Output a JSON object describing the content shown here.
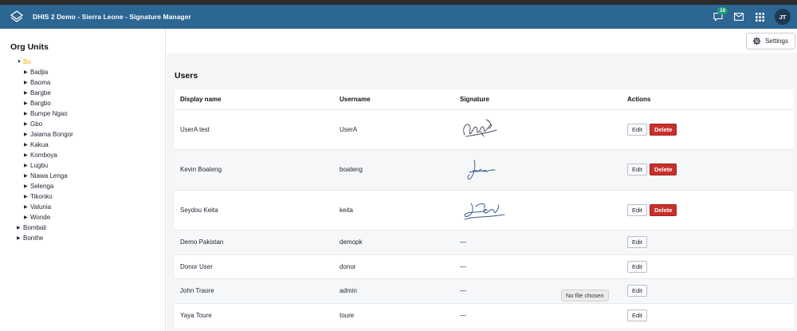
{
  "header": {
    "title": "DHIS 2 Demo - Sierra Leone - Signature Manager",
    "notification_count": "10",
    "avatar_initials": "JT",
    "bg_color": "#2c6693"
  },
  "sidebar": {
    "title": "Org Units",
    "tree": [
      {
        "label": "Bo",
        "level": 0,
        "expanded": true,
        "selected": true
      },
      {
        "label": "Badjia",
        "level": 1
      },
      {
        "label": "Baoma",
        "level": 1
      },
      {
        "label": "Bargbe",
        "level": 1
      },
      {
        "label": "Bargbo",
        "level": 1
      },
      {
        "label": "Bumpe Ngao",
        "level": 1
      },
      {
        "label": "Gbo",
        "level": 1
      },
      {
        "label": "Jaiama Bongor",
        "level": 1
      },
      {
        "label": "Kakua",
        "level": 1
      },
      {
        "label": "Komboya",
        "level": 1
      },
      {
        "label": "Lugbu",
        "level": 1
      },
      {
        "label": "Niawa Lenga",
        "level": 1
      },
      {
        "label": "Selenga",
        "level": 1
      },
      {
        "label": "Tikonko",
        "level": 1
      },
      {
        "label": "Valunia",
        "level": 1
      },
      {
        "label": "Wonde",
        "level": 1
      },
      {
        "label": "Bombali",
        "level": 0
      },
      {
        "label": "Bonthe",
        "level": 0
      }
    ]
  },
  "toolbar": {
    "settings_label": "Settings"
  },
  "users": {
    "title": "Users",
    "columns": [
      "Display name",
      "Username",
      "Signature",
      "Actions"
    ],
    "edit_label": "Edit",
    "delete_label": "Delete",
    "rows": [
      {
        "display_name": "UserA test",
        "username": "UserA",
        "signature": "image",
        "sig_style": "a"
      },
      {
        "display_name": "Kevin Boateng",
        "username": "boateng",
        "signature": "image",
        "sig_style": "b"
      },
      {
        "display_name": "Seydou Keita",
        "username": "keita",
        "signature": "image",
        "sig_style": "c"
      },
      {
        "display_name": "Demo Pakistan",
        "username": "demopk",
        "signature": "—"
      },
      {
        "display_name": "Donor User",
        "username": "donor",
        "signature": "—"
      },
      {
        "display_name": "John Traore",
        "username": "admin",
        "signature": "—"
      },
      {
        "display_name": "Yaya Toure",
        "username": "toure",
        "signature": "—"
      }
    ]
  },
  "tooltip": {
    "text": "No file chosen"
  },
  "colors": {
    "accent": "#2c6693",
    "danger": "#c7302c",
    "selected_org": "#f0a500"
  }
}
